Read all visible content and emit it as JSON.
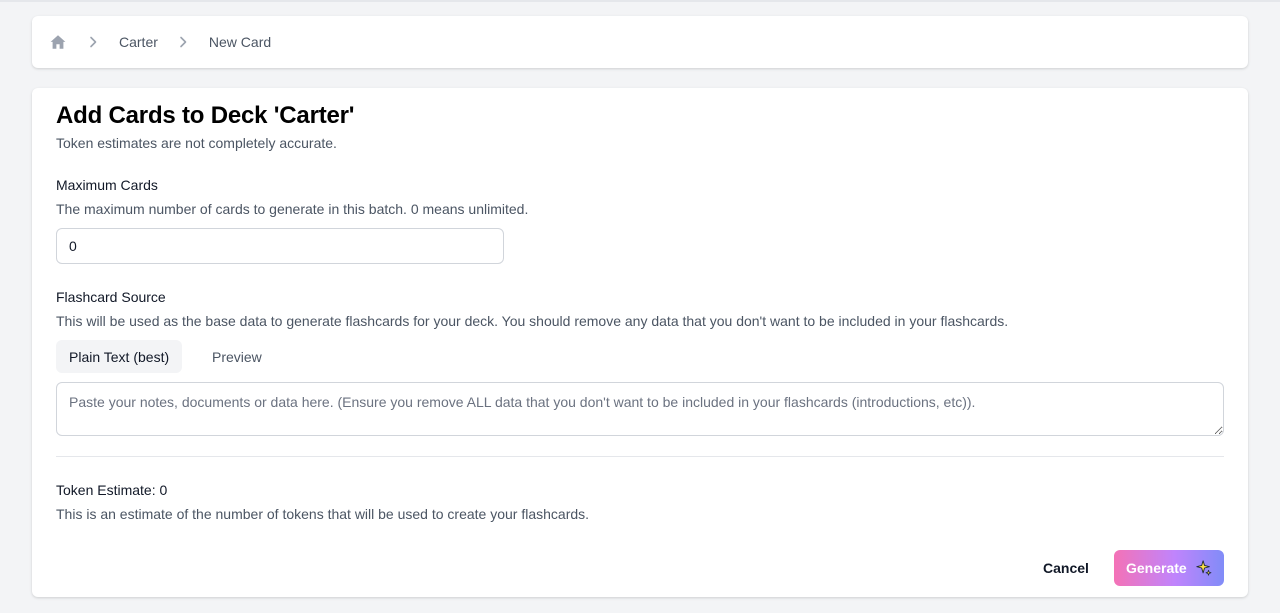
{
  "breadcrumb": {
    "home_icon": "home-icon",
    "separator_icon": "chevron-right-icon",
    "items": [
      "Carter",
      "New Card"
    ]
  },
  "page": {
    "title": "Add Cards to Deck 'Carter'",
    "subtitle": "Token estimates are not completely accurate."
  },
  "max_cards": {
    "label": "Maximum Cards",
    "help": "The maximum number of cards to generate in this batch. 0 means unlimited.",
    "value": "0"
  },
  "source": {
    "label": "Flashcard Source",
    "help": "This will be used as the base data to generate flashcards for your deck. You should remove any data that you don't want to be included in your flashcards.",
    "tabs": [
      "Plain Text (best)",
      "Preview"
    ],
    "active_tab": "Plain Text (best)",
    "placeholder": "Paste your notes, documents or data here. (Ensure you remove ALL data that you don't want to be included in your flashcards (introductions, etc))."
  },
  "token_estimate": {
    "label": "Token Estimate: 0",
    "help": "This is an estimate of the number of tokens that will be used to create your flashcards."
  },
  "actions": {
    "cancel_label": "Cancel",
    "generate_label": "Generate",
    "generate_icon": "sparkle-icon"
  },
  "colors": {
    "background": "#f3f4f6",
    "card": "#ffffff",
    "accent_gradient": [
      "#f472b6",
      "#c084fc",
      "#818cf8"
    ],
    "muted_text": "#4b5563"
  }
}
